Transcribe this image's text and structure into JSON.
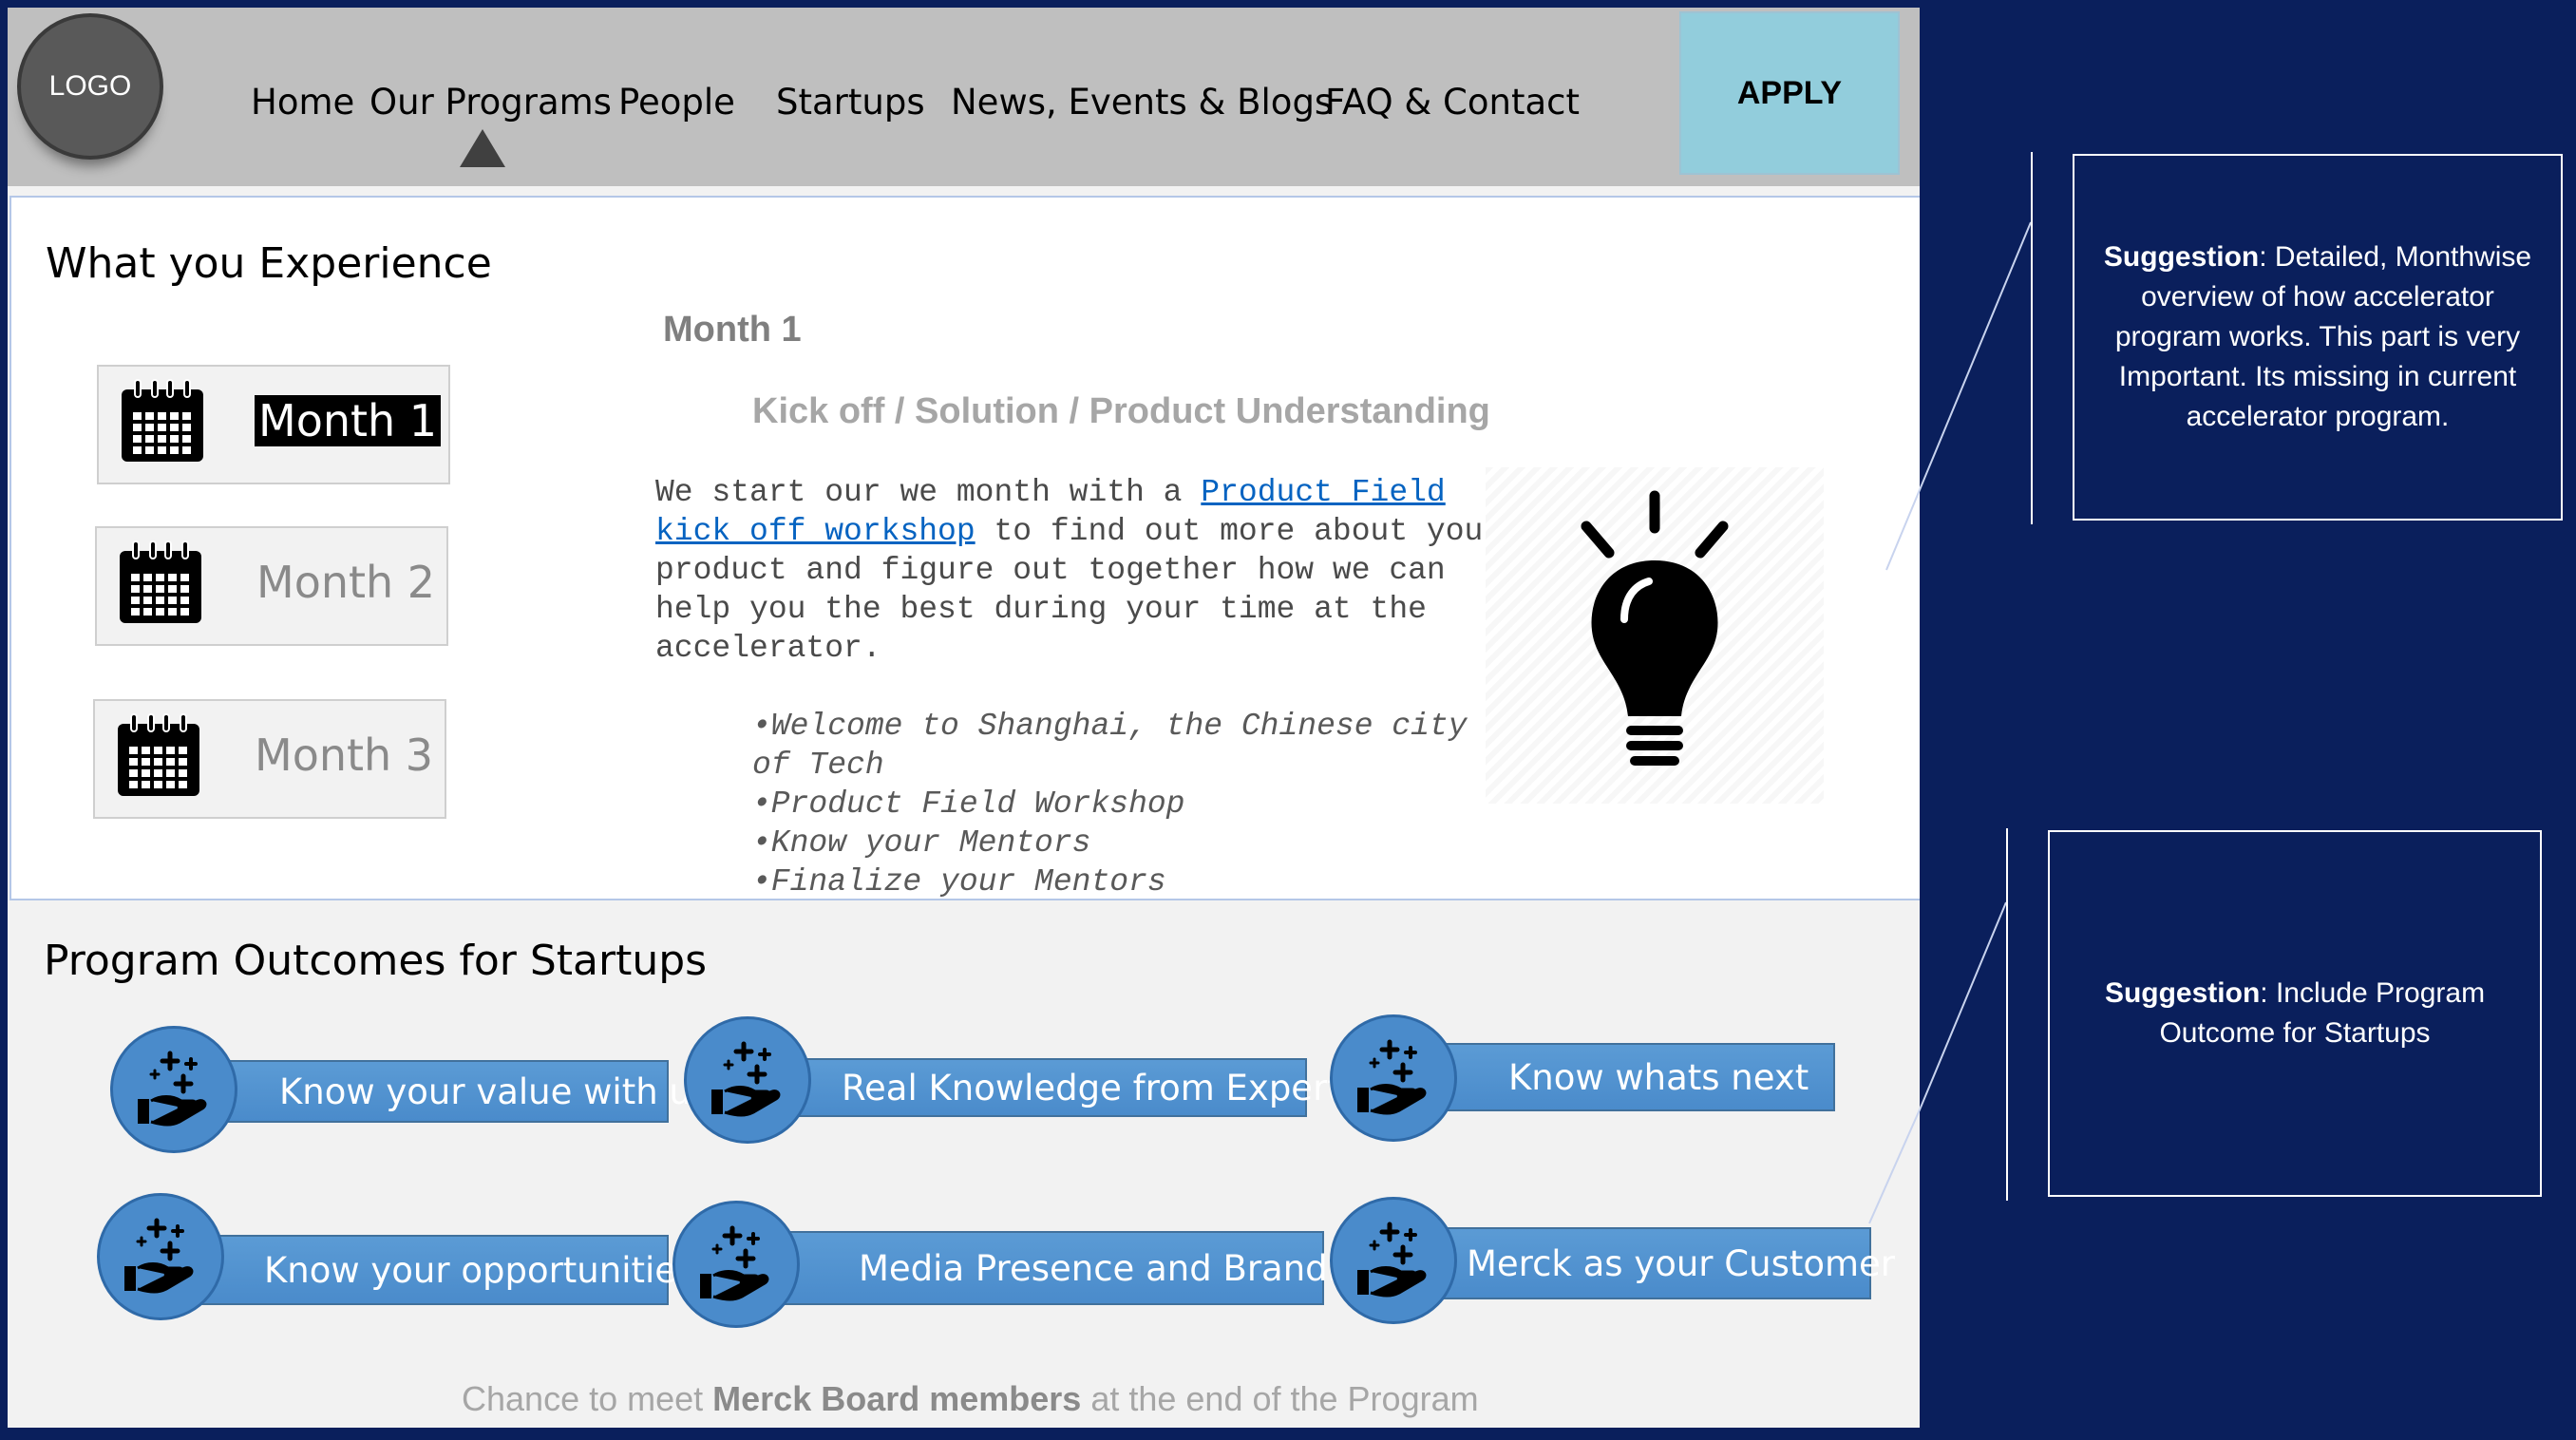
{
  "header": {
    "logo_text": "LOGO",
    "nav": [
      "Home",
      "Our Programs",
      "People",
      "Startups",
      "News, Events & Blogs",
      "FAQ & Contact"
    ],
    "active_nav": "Our Programs",
    "apply_label": "APPLY"
  },
  "experience": {
    "title": "What you Experience",
    "months": [
      "Month 1",
      "Month 2",
      "Month 3"
    ],
    "selected_month": "Month 1",
    "month_heading": "Month 1",
    "month_subtitle": "Kick off / Solution / Product Understanding",
    "text_before_link": "We start our we month with a ",
    "link_text": "Product Field kick off workshop",
    "text_after_link": " to find out more about your product and figure out together how we can help you the best during your time at the accelerator.",
    "bullets": [
      "•Welcome to Shanghai, the Chinese city of Tech",
      "•Product Field Workshop",
      "•Know your Mentors",
      "•Finalize your Mentors"
    ]
  },
  "outcomes": {
    "title": "Program Outcomes for Startups",
    "items": [
      "Know your value with us",
      "Real Knowledge from Experts",
      "Know whats next",
      "Know your opportunities",
      "Media Presence and Branding",
      "Merck as your Customer"
    ],
    "footnote_before": "Chance to meet ",
    "footnote_bold": "Merck Board members",
    "footnote_after": " at the end of the Program"
  },
  "notes": [
    {
      "bold": "Suggestion",
      "text": ": Detailed, Monthwise overview of how accelerator program works. This part is very Important. Its missing in current accelerator program."
    },
    {
      "bold": "Suggestion",
      "text": ": Include Program Outcome for Startups"
    }
  ],
  "colors": {
    "background": "#0a1f5c",
    "header": "#bfbfbf",
    "apply": "#92cddc",
    "outcome_blue": "#5b9bd5",
    "link": "#0563c1"
  }
}
